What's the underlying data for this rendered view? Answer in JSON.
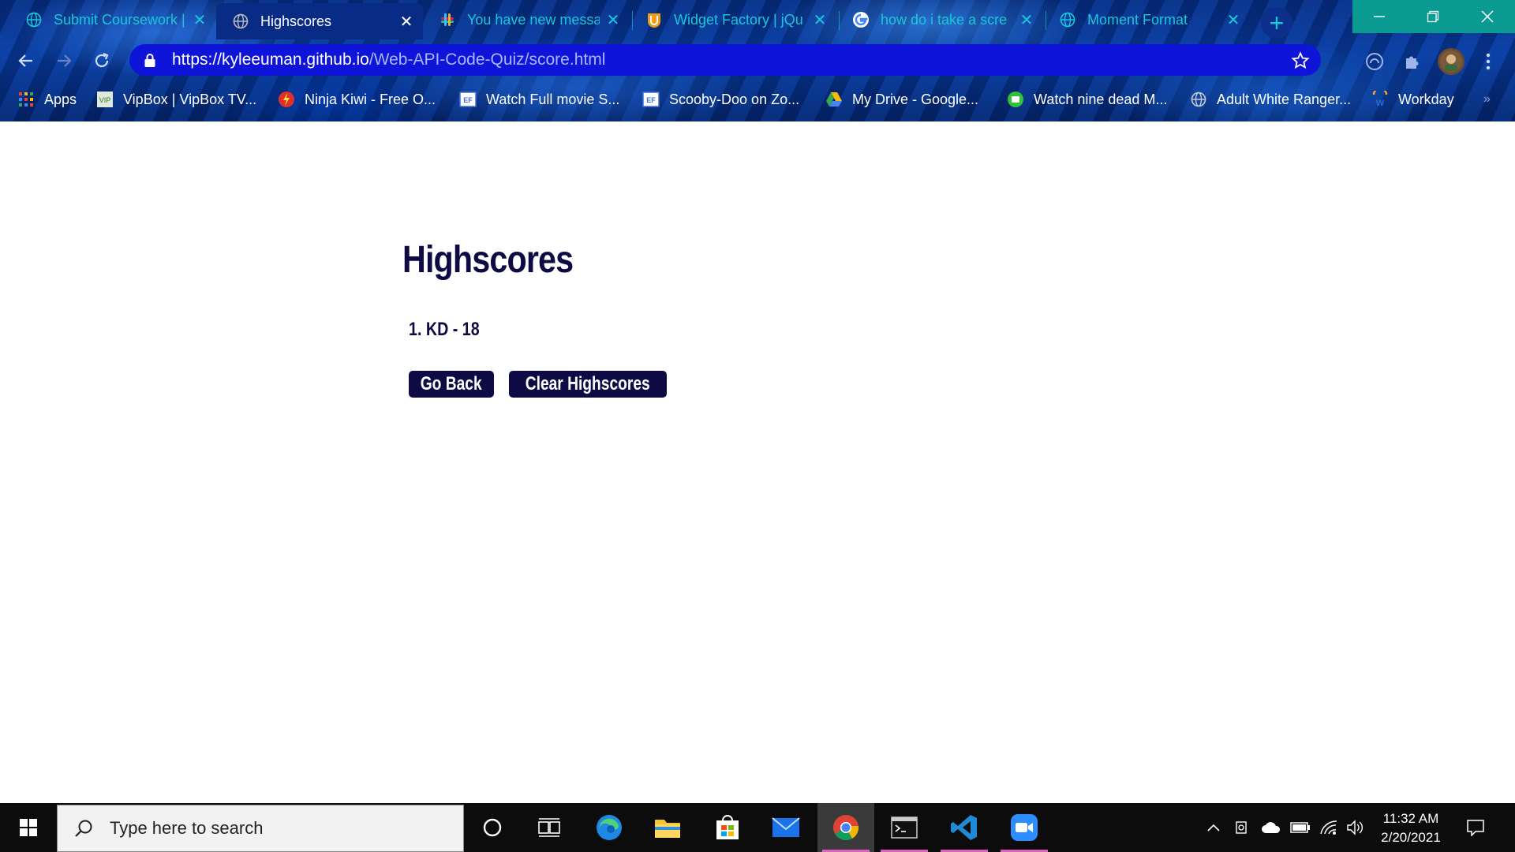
{
  "browser": {
    "tabs": [
      {
        "title": "Submit Coursework | ",
        "favicon": "globe-icon"
      },
      {
        "title": "Highscores",
        "favicon": "globe-icon",
        "active": true
      },
      {
        "title": "You have new messa",
        "favicon": "slack-icon"
      },
      {
        "title": "Widget Factory | jQu",
        "favicon": "jquery-ui-icon"
      },
      {
        "title": "how do i take a scre",
        "favicon": "google-icon"
      },
      {
        "title": "Moment Format",
        "favicon": "globe-icon"
      }
    ],
    "url_host": "https://kyleeuman.github.io",
    "url_path": "/Web-API-Code-Quiz/score.html",
    "bookmarks": [
      {
        "label": "Apps",
        "icon": "apps-grid-icon"
      },
      {
        "label": "VipBox | VipBox TV...",
        "icon": "vipbox-icon"
      },
      {
        "label": "Ninja Kiwi - Free O...",
        "icon": "ninja-kiwi-icon"
      },
      {
        "label": "Watch Full movie S...",
        "icon": "ef-icon"
      },
      {
        "label": "Scooby-Doo on Zo...",
        "icon": "ef-icon"
      },
      {
        "label": "My Drive - Google...",
        "icon": "google-drive-icon"
      },
      {
        "label": "Watch nine dead M...",
        "icon": "green-play-icon"
      },
      {
        "label": "Adult White Ranger...",
        "icon": "globe-icon"
      },
      {
        "label": "Workday",
        "icon": "workday-icon"
      }
    ]
  },
  "page": {
    "title": "Highscores",
    "scores": [
      "1. KD - 18"
    ],
    "go_back_label": "Go Back",
    "clear_label": "Clear Highscores"
  },
  "taskbar": {
    "search_placeholder": "Type here to search",
    "time": "11:32 AM",
    "date": "2/20/2021"
  },
  "colors": {
    "accent_text": "#0e0b44",
    "tab_inactive_text": "#18c8d8",
    "omnibox": "#0e14d8"
  }
}
